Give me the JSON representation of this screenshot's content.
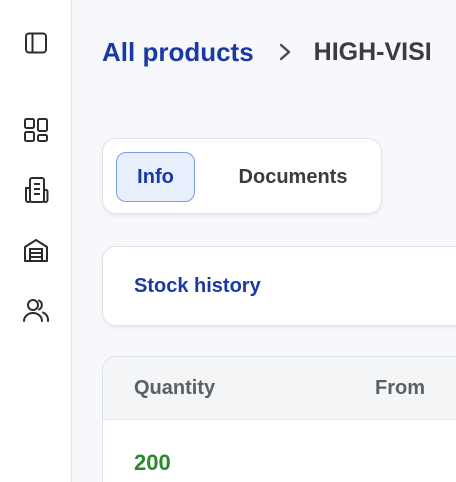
{
  "sidebar": {
    "items": [
      {
        "icon": "sidebar-toggle-icon"
      },
      {
        "icon": "dashboard-icon"
      },
      {
        "icon": "inventory-icon"
      },
      {
        "icon": "warehouse-icon"
      },
      {
        "icon": "users-icon"
      }
    ]
  },
  "breadcrumb": {
    "link_label": "All products",
    "separator_icon": "chevron-right-icon",
    "current": "HIGH-VISI"
  },
  "tabs": [
    {
      "label": "Info",
      "selected": true
    },
    {
      "label": "Documents",
      "selected": false
    }
  ],
  "stock_history": {
    "title": "Stock history"
  },
  "table": {
    "columns": [
      "Quantity",
      "From"
    ],
    "rows": [
      {
        "quantity": "200"
      }
    ]
  },
  "colors": {
    "accent": "#1a3aa3",
    "positive": "#2a8a2a",
    "selected_tab_bg": "#e7eefc",
    "selected_tab_border": "#7d9de3"
  }
}
